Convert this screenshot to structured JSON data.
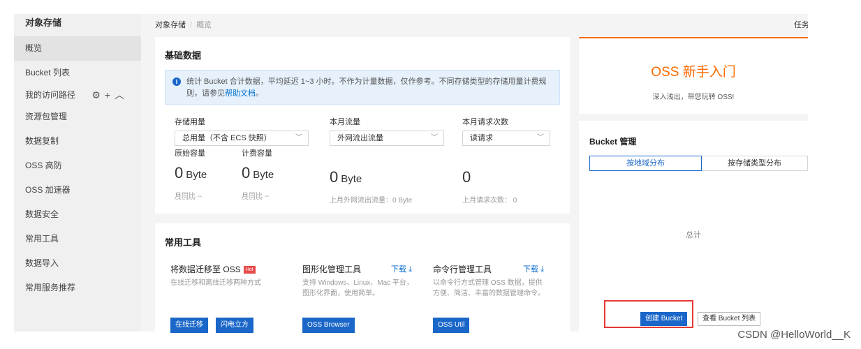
{
  "sidebar": {
    "title": "对象存储",
    "items": [
      {
        "label": "概览",
        "active": true
      },
      {
        "label": "Bucket 列表"
      },
      {
        "label": "我的访问路径"
      },
      {
        "label": "资源包管理"
      },
      {
        "label": "数据复制"
      },
      {
        "label": "OSS 高防"
      },
      {
        "label": "OSS 加速器"
      },
      {
        "label": "数据安全"
      },
      {
        "label": "常用工具"
      },
      {
        "label": "数据导入"
      },
      {
        "label": "常用服务推荐"
      }
    ],
    "access_path_icons": [
      "gear-icon",
      "plus-icon",
      "chevron-up-icon"
    ]
  },
  "breadcrumb": {
    "root": "对象存储",
    "sep": "/",
    "current": "概览"
  },
  "top_right": "任务",
  "basic_data": {
    "title": "基础数据",
    "notice_prefix": "统计 Bucket 合计数据，平均延迟 1~3 小时。不作为计量数据，仅作参考。不同存储类型的存储用量计费规则，请参见",
    "notice_link": "帮助文档",
    "notice_suffix": "。",
    "storage": {
      "label": "存储用量",
      "select": "总用量（不含 ECS 快照）",
      "original_label": "原始容量",
      "billing_label": "计费容量",
      "original_value": "0",
      "original_unit": "Byte",
      "billing_value": "0",
      "billing_unit": "Byte",
      "mom_label": "月同比",
      "mom_value": "--",
      "mom2_value": "--"
    },
    "traffic": {
      "label": "本月流量",
      "select": "外网流出流量",
      "value": "0",
      "unit": "Byte",
      "last_month": "上月外网流出流量：0 Byte"
    },
    "requests": {
      "label": "本月请求次数",
      "select": "读请求",
      "value": "0",
      "last_month": "上月请求次数：  0"
    }
  },
  "tools": {
    "title": "常用工具",
    "items": [
      {
        "name": "将数据迁移至 OSS",
        "badge": "Hot",
        "desc": "在线迁移和离线迁移两种方式",
        "buttons": [
          "在线迁移",
          "闪电立方"
        ]
      },
      {
        "name": "图形化管理工具",
        "download": "下载",
        "desc_line1": "支持 Windows、Linux、Mac 平台，",
        "desc_line2": "图形化界面，使用简单。",
        "buttons": [
          "OSS Browser"
        ]
      },
      {
        "name": "命令行管理工具",
        "download": "下载",
        "desc_line1": "以命令行方式管理 OSS 数据，提供",
        "desc_line2": "方便、简洁、丰富的数据管理命令。",
        "buttons": [
          "OSS Util"
        ]
      }
    ]
  },
  "oss_intro": {
    "title": "OSS 新手入门",
    "subtitle": "深入浅出，带您玩转 OSS!"
  },
  "bucket_mgmt": {
    "title": "Bucket 管理",
    "tabs": [
      "按地域分布",
      "按存储类型分布"
    ],
    "total_label": "总计",
    "create_button": "创建 Bucket",
    "list_button": "查看 Bucket 列表"
  },
  "colors": {
    "accent": "#1a66c9",
    "brand_orange": "#ff6a00",
    "highlight": "#e53935"
  },
  "watermark": "CSDN @HelloWorld__K"
}
